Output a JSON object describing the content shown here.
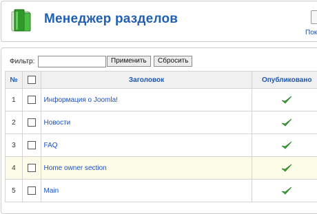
{
  "header": {
    "title": "Менеджер разделов",
    "toolbar_label_partial": "Пок"
  },
  "filter": {
    "label": "Фильтр:",
    "value": "",
    "apply_label": "Применить",
    "reset_label": "Сбросить"
  },
  "table": {
    "columns": {
      "num": "№",
      "title": "Заголовок",
      "published": "Опубликовано"
    },
    "rows": [
      {
        "num": "1",
        "title": "Информация о Joomla!",
        "published": true
      },
      {
        "num": "2",
        "title": "Новости",
        "published": true
      },
      {
        "num": "3",
        "title": "FAQ",
        "published": true
      },
      {
        "num": "4",
        "title": "Home owner section",
        "published": true
      },
      {
        "num": "5",
        "title": "Main",
        "published": true
      }
    ]
  },
  "colors": {
    "title": "#1f5fb4",
    "link": "#1a4fc4",
    "check": "#3aa62f",
    "highlight_row": "#fdfce8",
    "icon_green": "#33a02c"
  },
  "icons": {
    "header": "section-manager-icon",
    "published": "check-icon"
  }
}
